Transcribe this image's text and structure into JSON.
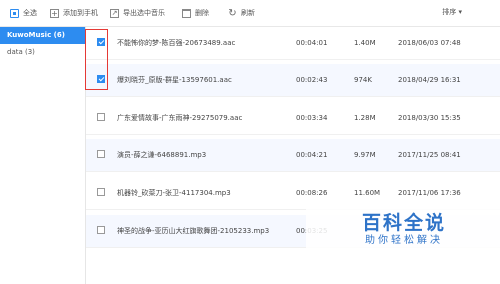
{
  "toolbar": {
    "select_all": "全选",
    "add_to_phone": "添加到手机",
    "export": "导出选中音乐",
    "delete": "删除",
    "refresh": "刷新",
    "sort": "排序 ▾"
  },
  "sidebar": {
    "items": [
      {
        "label": "KuwoMusic (6)"
      },
      {
        "label": "data (3)"
      }
    ]
  },
  "list": {
    "rows": [
      {
        "name": "不能怖你的梦-陈百强-20673489.aac",
        "duration": "00:04:01",
        "size": "1.40M",
        "date": "2018/06/03 07:48",
        "checked": true
      },
      {
        "name": "爆刘晓芬_原版-群星-13597601.aac",
        "duration": "00:02:43",
        "size": "974K",
        "date": "2018/04/29 16:31",
        "checked": true
      },
      {
        "name": "广东爱情故事-广东雨神-29275079.aac",
        "duration": "00:03:34",
        "size": "1.28M",
        "date": "2018/03/30 15:35",
        "checked": false
      },
      {
        "name": "演员-薛之谦-6468891.mp3",
        "duration": "00:04:21",
        "size": "9.97M",
        "date": "2017/11/25 08:41",
        "checked": false
      },
      {
        "name": "机器铃_砍菜刀-张卫-4117304.mp3",
        "duration": "00:08:26",
        "size": "11.60M",
        "date": "2017/11/06 17:36",
        "checked": false
      },
      {
        "name": "神圣的战争-亚历山大红旗歌舞团-2105233.mp3",
        "duration": "00:03:25",
        "size": "",
        "date": "",
        "checked": false
      }
    ]
  },
  "watermark": {
    "big": "百科全说",
    "small": "助你轻松解决"
  }
}
